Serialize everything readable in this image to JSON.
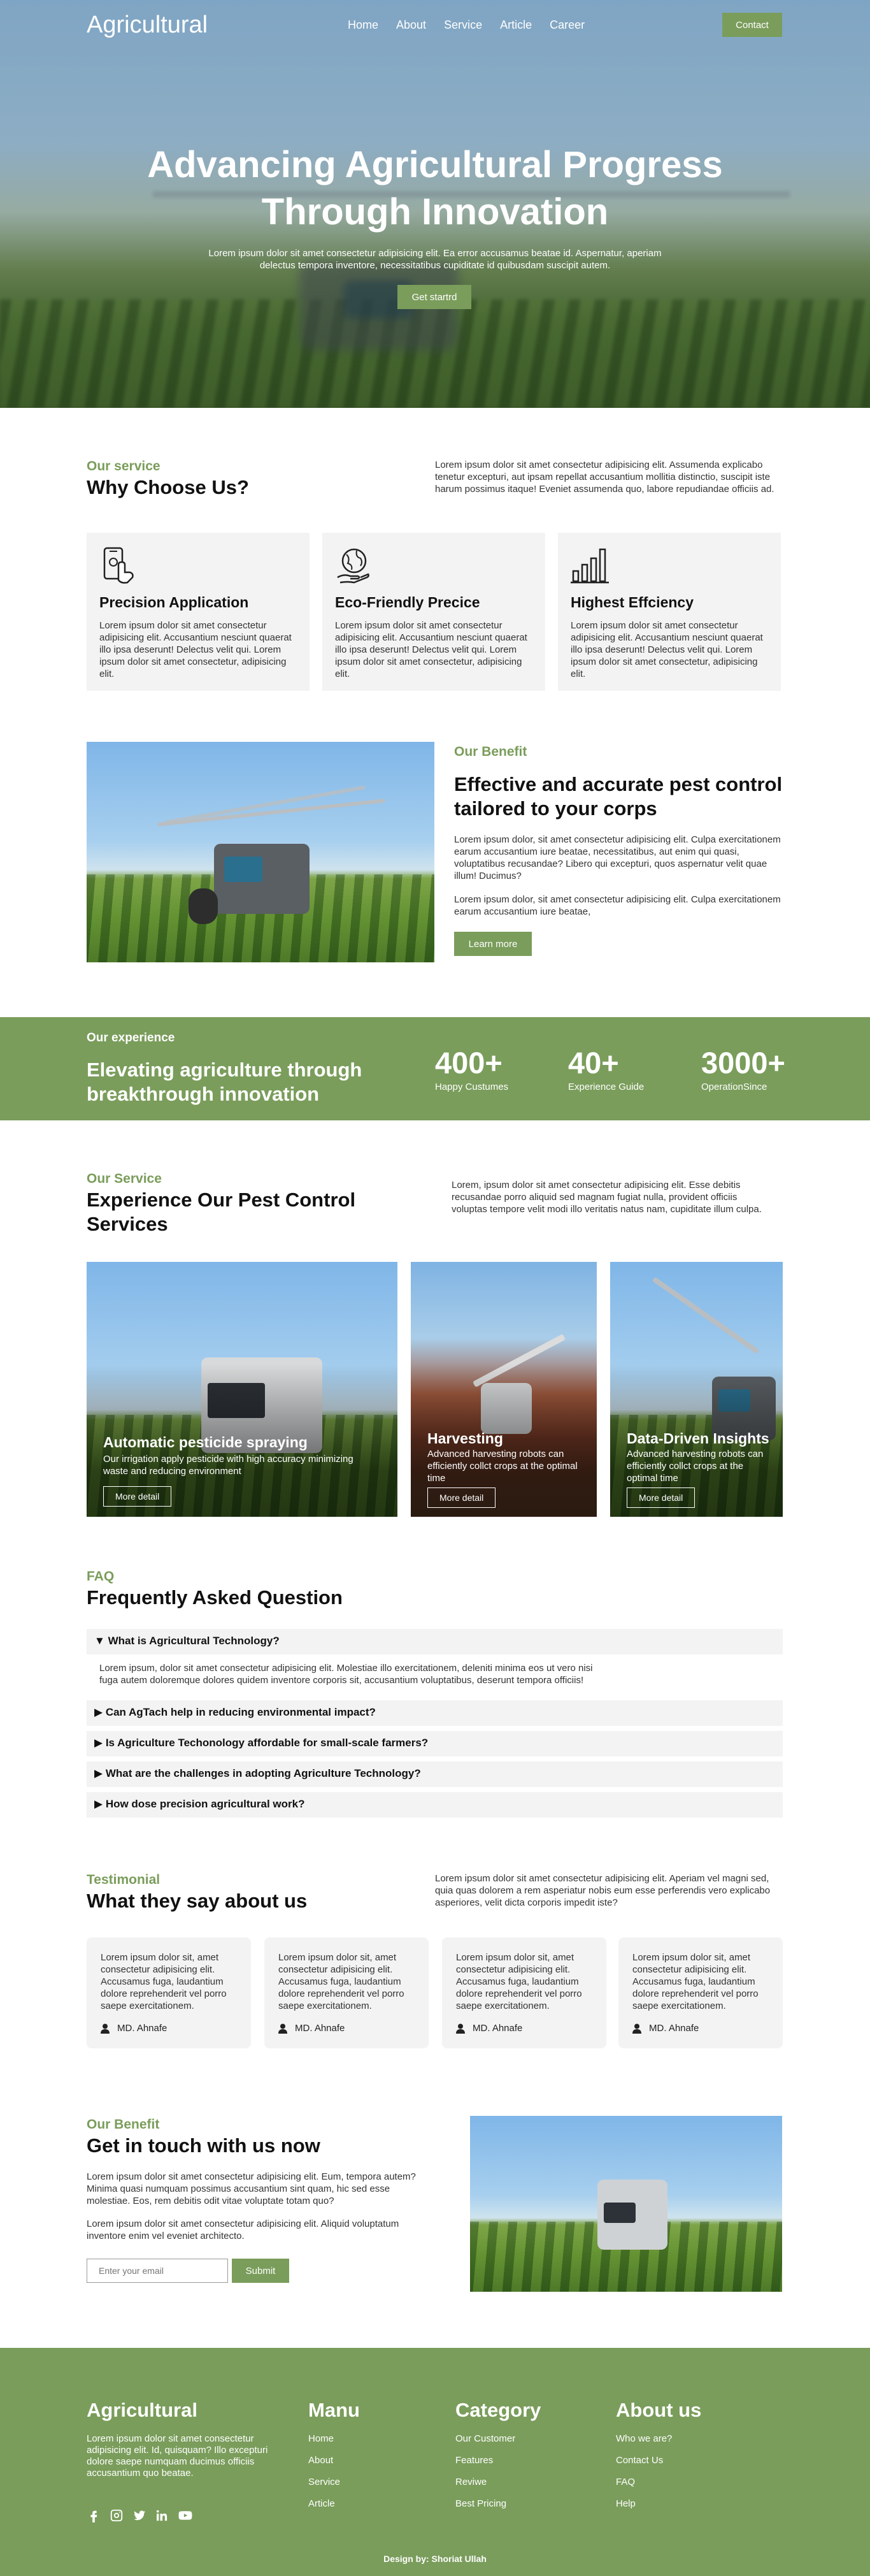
{
  "nav": {
    "logo": "Agricultural",
    "items": [
      "Home",
      "About",
      "Service",
      "Article",
      "Career"
    ],
    "contact_label": "Contact"
  },
  "hero": {
    "title_line1": "Advancing Agricultural Progress",
    "title_line2": "Through Innovation",
    "subtitle": "Lorem ipsum dolor sit amet consectetur adipisicing elit. Ea error accusamus beatae id. Aspernatur, aperiam delectus tempora inventore, necessitatibus cupiditate id quibusdam suscipit autem.",
    "cta": "Get startrd"
  },
  "why": {
    "eyebrow": "Our service",
    "title": "Why Choose Us?",
    "intro": "Lorem ipsum dolor sit amet consectetur adipisicing elit. Assumenda explicabo tenetur excepturi, aut ipsam repellat accusantium mollitia distinctio, suscipit iste harum possimus itaque! Eveniet assumenda quo, labore repudiandae officiis ad.",
    "cards": [
      {
        "icon": "phone-tap-icon",
        "title": "Precision Application",
        "text": "Lorem ipsum dolor sit amet consectetur adipisicing elit. Accusantium nesciunt quaerat illo ipsa deserunt! Delectus velit qui. Lorem ipsum dolor sit amet consectetur, adipisicing elit."
      },
      {
        "icon": "eco-globe-icon",
        "title": "Eco-Friendly Precice",
        "text": "Lorem ipsum dolor sit amet consectetur adipisicing elit. Accusantium nesciunt quaerat illo ipsa deserunt! Delectus velit qui. Lorem ipsum dolor sit amet consectetur, adipisicing elit."
      },
      {
        "icon": "bar-chart-icon",
        "title": "Highest Effciency",
        "text": "Lorem ipsum dolor sit amet consectetur adipisicing elit. Accusantium nesciunt quaerat illo ipsa deserunt! Delectus velit qui. Lorem ipsum dolor sit amet consectetur, adipisicing elit."
      }
    ]
  },
  "benefit": {
    "eyebrow": "Our Benefit",
    "title": "Effective and accurate pest control tailored to your corps",
    "p1": "Lorem ipsum dolor, sit amet consectetur adipisicing elit. Culpa exercitationem earum accusantium iure beatae, necessitatibus, aut enim qui quasi, voluptatibus recusandae? Libero qui excepturi, quos aspernatur velit quae illum! Ducimus?",
    "p2": "Lorem ipsum dolor, sit amet consectetur adipisicing elit. Culpa exercitationem earum accusantium iure beatae,",
    "cta": "Learn more"
  },
  "experience": {
    "label": "Our experience",
    "title": "Elevating agriculture through breakthrough innovation",
    "stats": [
      {
        "num": "400+",
        "cap": "Happy Custumes"
      },
      {
        "num": "40+",
        "cap": "Experience Guide"
      },
      {
        "num": "3000+",
        "cap": "OperationSince"
      }
    ]
  },
  "pest": {
    "eyebrow": "Our Service",
    "title": "Experience Our Pest Control Services",
    "intro": "Lorem, ipsum dolor sit amet consectetur adipisicing elit. Esse debitis recusandae porro aliquid sed magnam fugiat nulla, provident officiis voluptas tempore velit modi illo veritatis natus nam, cupiditate illum culpa.",
    "cards": [
      {
        "title": "Automatic pesticide spraying",
        "text": "Our irrigation apply pesticide with high accuracy minimizing waste and reducing environment",
        "btn": "More detail"
      },
      {
        "title": "Harvesting",
        "text": "Advanced harvesting robots can efficiently collct crops at the optimal time",
        "btn": "More detail"
      },
      {
        "title": "Data-Driven Insights",
        "text": "Advanced harvesting robots can efficiently collct crops at the optimal time",
        "btn": "More detail"
      }
    ]
  },
  "faq": {
    "eyebrow": "FAQ",
    "title": "Frequently Asked Question",
    "items": [
      {
        "q": "What is Agricultural Technology?",
        "a": "Lorem ipsum, dolor sit amet consectetur adipisicing elit. Molestiae illo exercitationem, deleniti minima eos ut vero nisi fuga autem doloremque dolores quidem inventore corporis sit, accusantium voluptatibus, deserunt tempora officiis!"
      },
      {
        "q": "Can AgTach help in reducing environmental impact?"
      },
      {
        "q": "Is Agriculture Techonology affordable for small-scale farmers?"
      },
      {
        "q": "What are the challenges in adopting Agriculture Technology?"
      },
      {
        "q": "How dose precision agricultural work?"
      }
    ],
    "open_marker": "▼",
    "closed_marker": "▶"
  },
  "testimonial": {
    "eyebrow": "Testimonial",
    "title": "What they say about us",
    "intro": "Lorem ipsum dolor sit amet consectetur adipisicing elit. Aperiam vel magni sed, quia quas dolorem a rem asperiatur nobis eum esse perferendis vero explicabo asperiores, velit dicta corporis impedit iste?",
    "cards": [
      {
        "text": "Lorem ipsum dolor sit, amet consectetur adipisicing elit. Accusamus fuga, laudantium dolore reprehenderit vel porro saepe exercitationem.",
        "author": "MD. Ahnafe"
      },
      {
        "text": "Lorem ipsum dolor sit, amet consectetur adipisicing elit. Accusamus fuga, laudantium dolore reprehenderit vel porro saepe exercitationem.",
        "author": "MD. Ahnafe"
      },
      {
        "text": "Lorem ipsum dolor sit, amet consectetur adipisicing elit. Accusamus fuga, laudantium dolore reprehenderit vel porro saepe exercitationem.",
        "author": "MD. Ahnafe"
      },
      {
        "text": "Lorem ipsum dolor sit, amet consectetur adipisicing elit. Accusamus fuga, laudantium dolore reprehenderit vel porro saepe exercitationem.",
        "author": "MD. Ahnafe"
      }
    ]
  },
  "contact": {
    "eyebrow": "Our Benefit",
    "title": "Get in touch with us now",
    "p1": "Lorem ipsum dolor sit amet consectetur adipisicing elit. Eum, tempora autem? Minima quasi numquam possimus accusantium sint quam, hic sed esse molestiae. Eos, rem debitis odit vitae voluptate totam quo?",
    "p2": "Lorem ipsum dolor sit amet consectetur adipisicing elit. Aliquid voluptatum inventore enim vel eveniet architecto.",
    "email_placeholder": "Enter your email",
    "submit": "Submit"
  },
  "footer": {
    "brand": "Agricultural",
    "about": "Lorem ipsum dolor sit amet consectetur adipisicing elit. Id, quisquam? Illo excepturi dolore saepe numquam ducimus officiis accusantium quo beatae.",
    "menu_title": "Manu",
    "menu": [
      "Home",
      "About",
      "Service",
      "Article"
    ],
    "category_title": "Category",
    "category": [
      "Our Customer",
      "Features",
      "Reviwe",
      "Best Pricing"
    ],
    "about_title": "About us",
    "about_links": [
      "Who we are?",
      "Contact Us",
      "FAQ",
      "Help"
    ],
    "credit": "Design by: Shoriat Ullah",
    "social_icons": [
      "facebook-icon",
      "instagram-icon",
      "twitter-icon",
      "linkedin-icon",
      "youtube-icon"
    ]
  },
  "colors": {
    "accent": "#7a9d5b",
    "card_bg": "#f3f3f3"
  }
}
